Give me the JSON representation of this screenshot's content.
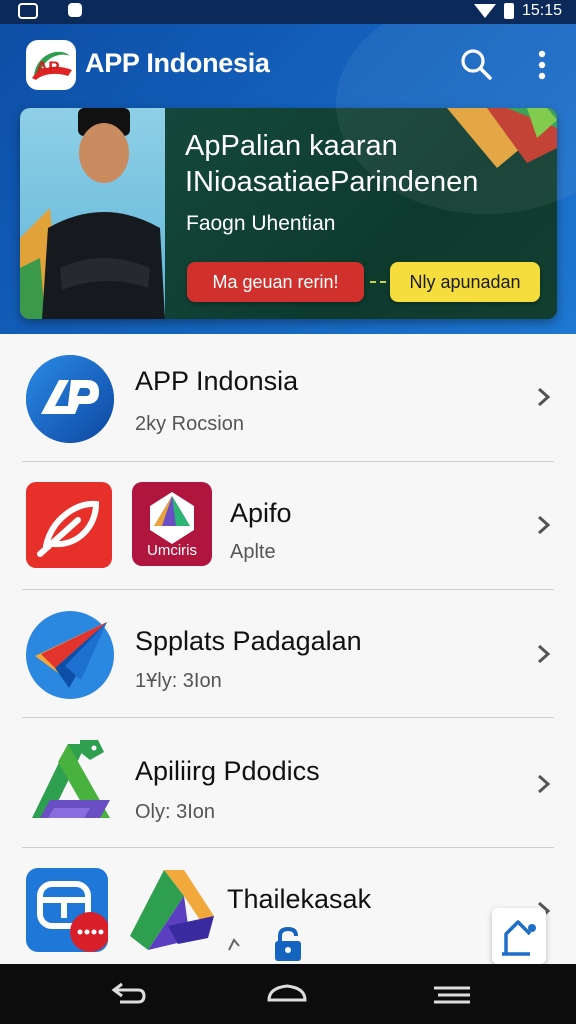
{
  "status_bar": {
    "time": "15:15"
  },
  "app_bar": {
    "title": "APP Indonesia",
    "logo_text": "AP",
    "icons": [
      "search-icon",
      "more-vert-icon"
    ]
  },
  "banner": {
    "title_line1": "ApPalian kaaran",
    "title_line2": "INioasatiaeParindenen",
    "subtitle": "Faogn Uhentian",
    "primary_button": "Ma geuan rerin!",
    "secondary_button": "Nly apunadan"
  },
  "apps": [
    {
      "name": "APP Indonsia",
      "meta": "2ky Rocsion",
      "icon": "ap-logo-icon"
    },
    {
      "name": "Apifo",
      "meta": "Aplte",
      "icon": "red-leaf-icon",
      "icon2": "umciris-icon",
      "icon2_label": "Umciris"
    },
    {
      "name": "Spplats Padagalan",
      "meta": "1Ұly: 3Ion",
      "icon": "paper-plane-icon"
    },
    {
      "name": "Apiliirg Pdodics",
      "meta": "Oly: 3Ion",
      "icon": "triangle-drive-icon"
    },
    {
      "name": "Thailekasak",
      "meta": "",
      "icon": "calendar-icon",
      "icon2": "triangle-prism-icon"
    }
  ],
  "colors": {
    "header": "#1565c0",
    "banner_bg": "#123f33",
    "primary_button": "#d0312d",
    "secondary_button": "#f4dd3c"
  }
}
